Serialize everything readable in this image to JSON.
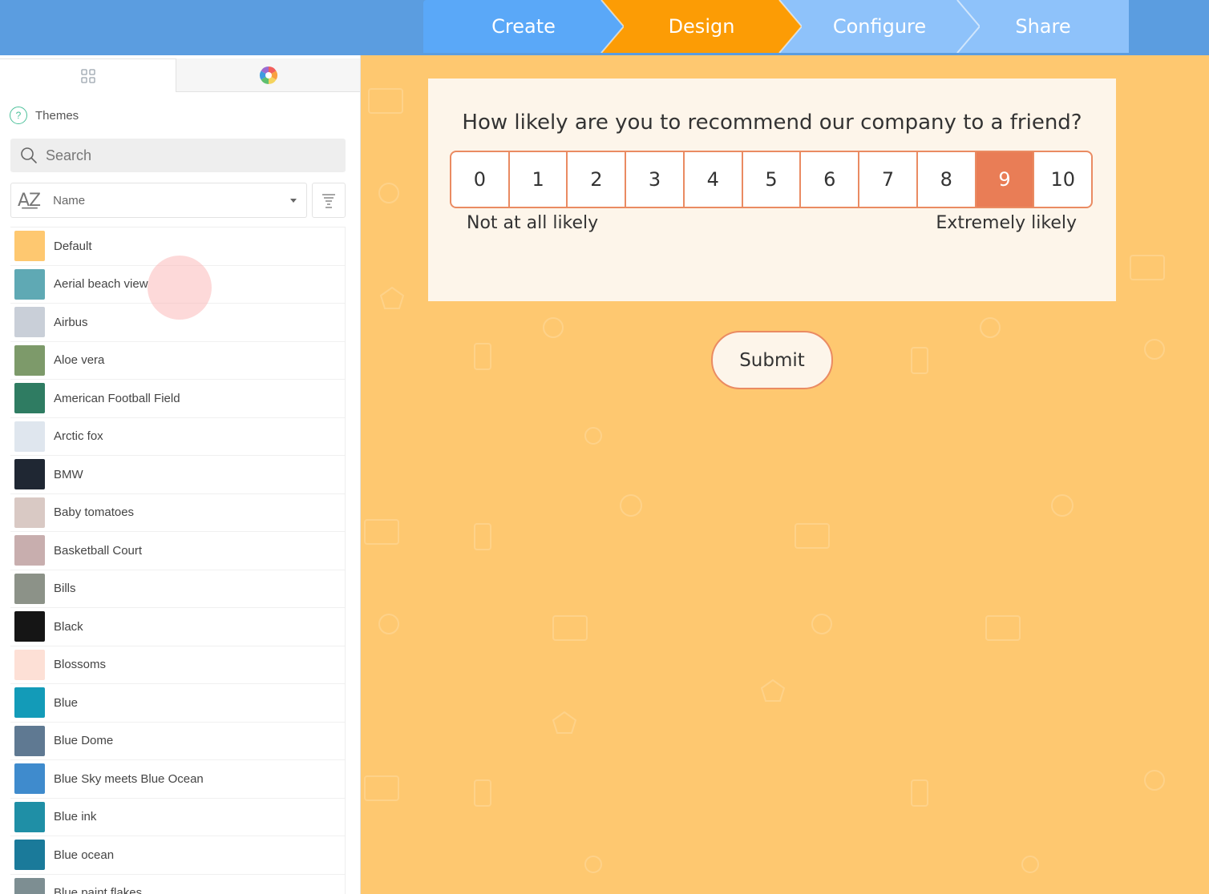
{
  "wizard": {
    "steps": [
      {
        "label": "Create"
      },
      {
        "label": "Design"
      },
      {
        "label": "Configure"
      },
      {
        "label": "Share"
      }
    ],
    "active_step": "Design",
    "colors": {
      "topbar": "#5b9de0",
      "create": "#5aa8f8",
      "active": "#fc9c05",
      "inactive": "#8ec2fa"
    }
  },
  "sidebar": {
    "tabs": [
      {
        "icon": "grid-icon"
      },
      {
        "icon": "color-wheel-icon"
      }
    ],
    "themes_label": "Themes",
    "search_placeholder": "Search",
    "sort": {
      "label": "Name",
      "icon": "sort-az-icon"
    },
    "filter_icon": "filter-icon",
    "themes": [
      {
        "name": "Default",
        "color": "#fec870"
      },
      {
        "name": "Aerial beach view",
        "color": "#5fa9b4"
      },
      {
        "name": "Airbus",
        "color": "#c9cfd8"
      },
      {
        "name": "Aloe vera",
        "color": "#7d9a6a"
      },
      {
        "name": "American Football Field",
        "color": "#2f7c62"
      },
      {
        "name": "Arctic fox",
        "color": "#dfe6ee"
      },
      {
        "name": "BMW",
        "color": "#1f2733"
      },
      {
        "name": "Baby tomatoes",
        "color": "#d9c9c4"
      },
      {
        "name": "Basketball Court",
        "color": "#c8aeae"
      },
      {
        "name": "Bills",
        "color": "#8c9288"
      },
      {
        "name": "Black",
        "color": "#151515"
      },
      {
        "name": "Blossoms",
        "color": "#fde0d6"
      },
      {
        "name": "Blue",
        "color": "#139bb8"
      },
      {
        "name": "Blue Dome",
        "color": "#5f7992"
      },
      {
        "name": "Blue Sky meets Blue Ocean",
        "color": "#3f8bcd"
      },
      {
        "name": "Blue ink",
        "color": "#1f8fa6"
      },
      {
        "name": "Blue ocean",
        "color": "#1a7a9a"
      },
      {
        "name": "Blue paint flakes",
        "color": "#7d8e92"
      }
    ]
  },
  "survey": {
    "question": "How likely are you to recommend our company to a friend?",
    "scale": [
      "0",
      "1",
      "2",
      "3",
      "4",
      "5",
      "6",
      "7",
      "8",
      "9",
      "10"
    ],
    "selected": 9,
    "low_label": "Not at all likely",
    "high_label": "Extremely likely",
    "submit_label": "Submit",
    "colors": {
      "background": "#fec870",
      "card": "#fdf5ea",
      "accent": "#e97d56"
    }
  }
}
